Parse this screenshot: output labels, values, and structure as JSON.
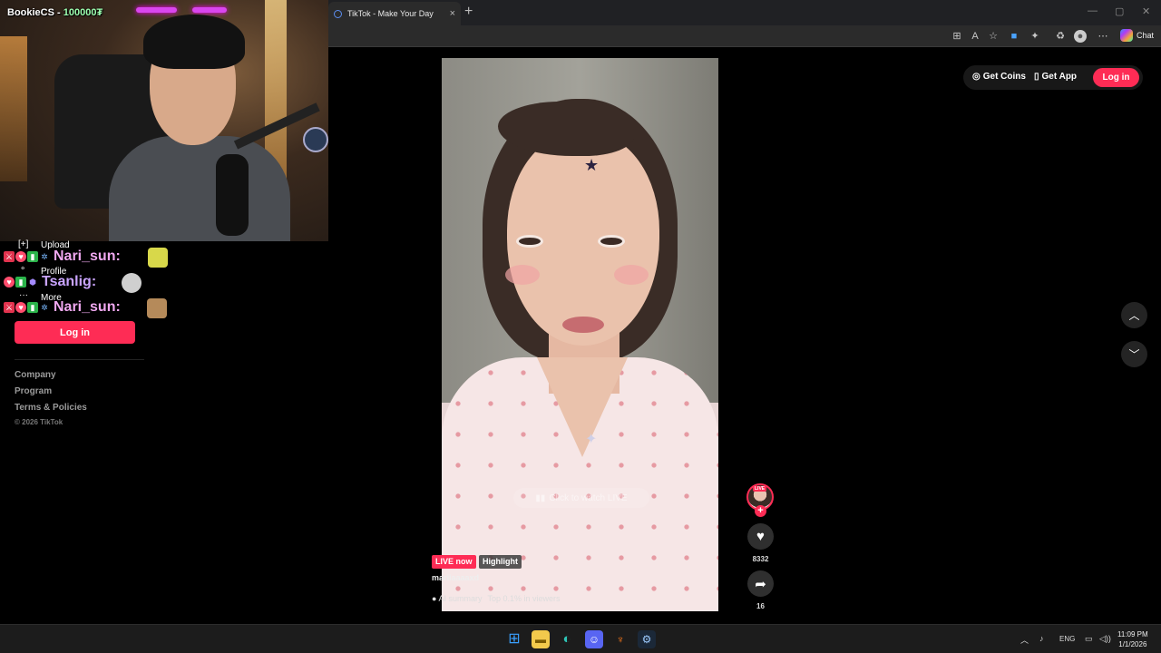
{
  "stream": {
    "streamer_name": "BookieCS",
    "streamer_count": "100000₮"
  },
  "browser": {
    "tab_title": "TikTok - Make Your Day",
    "tab_close": "×",
    "new_tab": "+",
    "chat_label": "Chat",
    "window_controls": [
      "—",
      "▢",
      "✕"
    ]
  },
  "nav": {
    "items": [
      {
        "icon": "[+]",
        "label": "Upload"
      },
      {
        "icon": "∘",
        "label": "Profile"
      },
      {
        "icon": "···",
        "label": "More"
      }
    ],
    "login_label": "Log in",
    "footer": [
      "Company",
      "Program",
      "Terms & Policies"
    ],
    "copyright": "© 2026 TikTok"
  },
  "chat": {
    "messages": [
      {
        "name": "Nari_sun:",
        "color": "#f0a8f0"
      },
      {
        "name": "Tsanlig:",
        "color": "#c9a4ff"
      },
      {
        "name": "Nari_sun:",
        "color": "#f0a8f0"
      }
    ]
  },
  "header": {
    "get_coins": "Get Coins",
    "get_app": "Get App",
    "login_label": "Log in"
  },
  "video": {
    "click_to_watch": "Click to watch LIVE",
    "live_badge": "LIVE now",
    "highlight_badge": "Highlight",
    "username": "mariiaaaaxd",
    "ai_summary": "AI summary",
    "top_viewers": "Top 0.1% in viewers"
  },
  "actions": {
    "live_mini": "LIVE",
    "likes": "8332",
    "shares": "16"
  },
  "taskbar": {
    "language": "ENG",
    "time": "11:09 PM",
    "date": "1/1/2026"
  },
  "colors": {
    "tiktok_red": "#fe2c55",
    "background": "#000000"
  }
}
